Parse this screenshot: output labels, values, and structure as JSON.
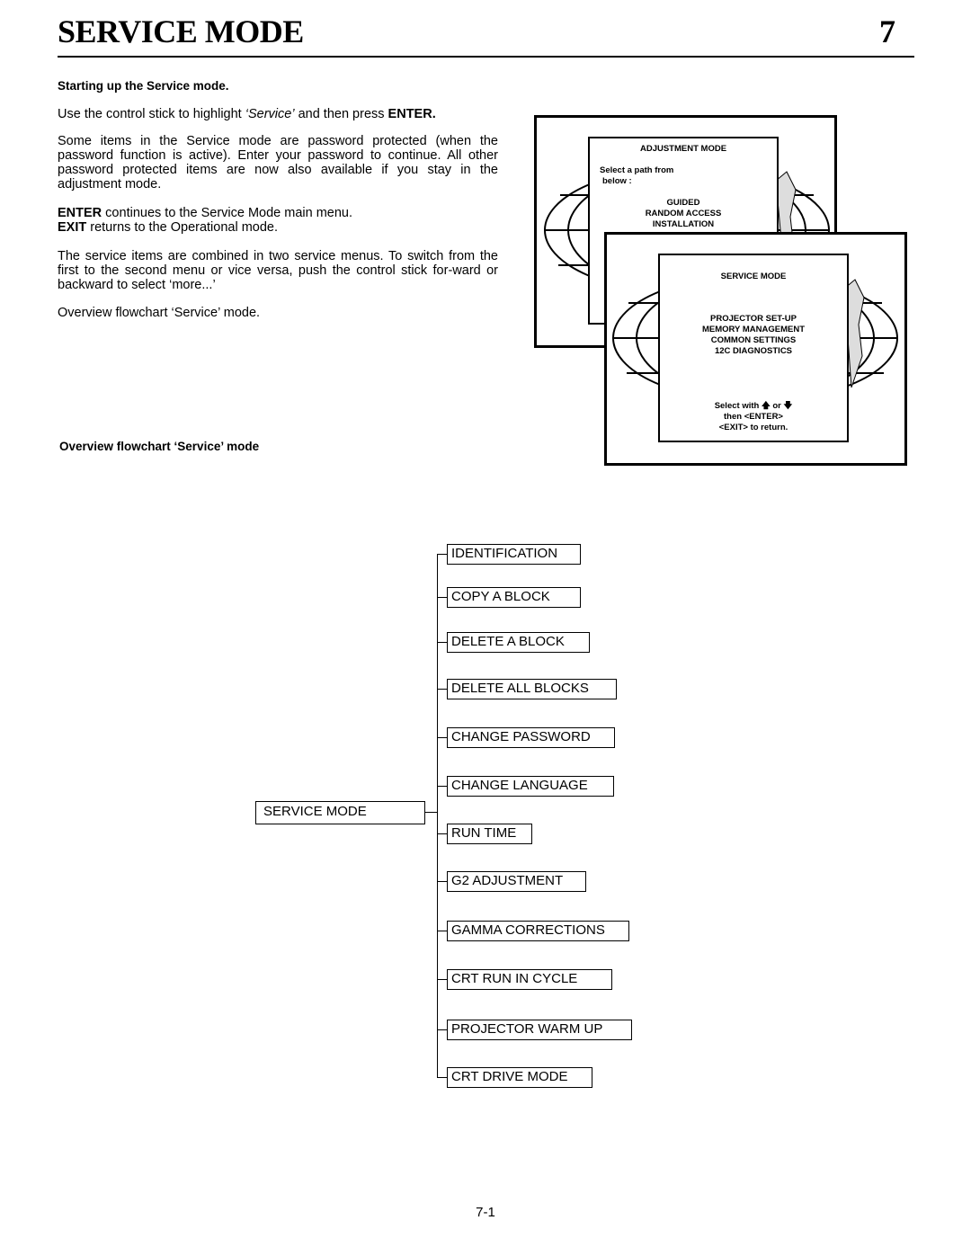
{
  "header": {
    "title": "SERVICE MODE",
    "chapter": "7"
  },
  "section_heading": "Starting up the Service mode.",
  "paragraphs": {
    "p1_pre": "Use the control stick to highlight ",
    "p1_em": "‘Service’",
    "p1_mid": " and then press ",
    "p1_b": "ENTER.",
    "p2": "Some items in the Service mode are password protected (when the password function is active). Enter your password to continue. All other password protected items are now also available if you stay in the adjustment mode.",
    "p3_b": "ENTER",
    "p3": " continues to the Service Mode main menu.",
    "p4_b": "EXIT",
    "p4": " returns to the Operational mode.",
    "p5": "The service items are combined in two service menus. To switch from the first to the second menu or vice versa, push the control stick for-ward or backward to select ‘more...’",
    "p6": "Overview flowchart ‘Service’ mode."
  },
  "figure_caption": "Overview flowchart ‘Service’ mode",
  "adjustment_screen": {
    "title": "ADJUSTMENT MODE",
    "prompt1": "Select a path from",
    "prompt2": "below :",
    "items": [
      "GUIDED",
      "RANDOM ACCESS",
      "INSTALLATION"
    ]
  },
  "service_screen": {
    "title": "SERVICE MODE",
    "items": [
      "PROJECTOR SET-UP",
      "MEMORY MANAGEMENT",
      "COMMON SETTINGS",
      "12C DIAGNOSTICS"
    ],
    "hint1": "Select with",
    "hint_or": "or",
    "hint2": "then  <ENTER>",
    "hint3": "<EXIT>  to return."
  },
  "flowchart": {
    "root": "SERVICE MODE",
    "items": [
      "IDENTIFICATION",
      "COPY A BLOCK",
      "DELETE A BLOCK",
      "DELETE ALL BLOCKS",
      "CHANGE PASSWORD",
      "CHANGE LANGUAGE",
      "RUN TIME",
      "G2 ADJUSTMENT",
      "GAMMA CORRECTIONS",
      "CRT RUN IN CYCLE",
      "PROJECTOR WARM UP",
      "CRT DRIVE MODE"
    ]
  },
  "footer": {
    "page_number": "7-1"
  }
}
